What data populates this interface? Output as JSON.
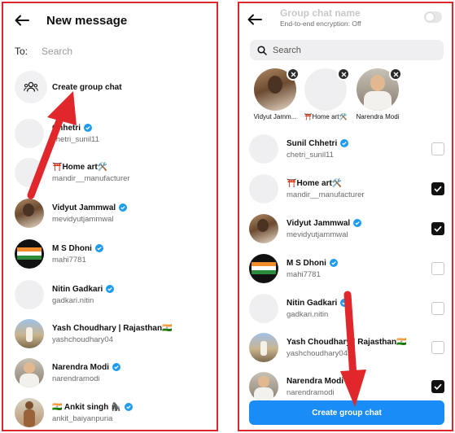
{
  "left": {
    "title": "New message",
    "to_label": "To:",
    "search_placeholder": "Search",
    "create_group_label": "Create group chat",
    "contacts": [
      {
        "name": "Chhetri",
        "handle": "chetri_sunil11",
        "verified": true,
        "icon": "blank-avatar"
      },
      {
        "name": "⛩️Home art🛠️",
        "handle": "mandir__manufacturer",
        "verified": false,
        "icon": "blank-avatar"
      },
      {
        "name": "Vidyut Jammwal",
        "handle": "mevidyutjammwal",
        "verified": true,
        "icon": "photo-avatar"
      },
      {
        "name": "M S Dhoni",
        "handle": "mahi7781",
        "verified": true,
        "icon": "photo-avatar"
      },
      {
        "name": "Nitin Gadkari",
        "handle": "gadkari.nitin",
        "verified": true,
        "icon": "blank-avatar"
      },
      {
        "name": "Yash Choudhary | Rajasthan🇮🇳",
        "handle": "yashchoudhary04",
        "verified": false,
        "icon": "photo-avatar"
      },
      {
        "name": "Narendra Modi",
        "handle": "narendramodi",
        "verified": true,
        "icon": "photo-avatar"
      },
      {
        "name": "🇮🇳 Ankit singh 🦍",
        "handle": "ankit_baiyanpuria",
        "verified": true,
        "icon": "photo-avatar"
      }
    ]
  },
  "right": {
    "group_name_placeholder": "Group chat name",
    "encryption_status": "End-to-end encryption: Off",
    "search_placeholder": "Search",
    "selected": [
      {
        "name": "Vidyut Jamm..."
      },
      {
        "name": "⛩️Home art🛠️"
      },
      {
        "name": "Narendra Modi"
      }
    ],
    "contacts": [
      {
        "name": "Sunil Chhetri",
        "handle": "chetri_sunil11",
        "verified": true,
        "checked": false
      },
      {
        "name": "⛩️Home art🛠️",
        "handle": "mandir__manufacturer",
        "verified": false,
        "checked": true
      },
      {
        "name": "Vidyut Jammwal",
        "handle": "mevidyutjammwal",
        "verified": true,
        "checked": true
      },
      {
        "name": "M S Dhoni",
        "handle": "mahi7781",
        "verified": true,
        "checked": false
      },
      {
        "name": "Nitin Gadkari",
        "handle": "gadkari.nitin",
        "verified": true,
        "checked": false
      },
      {
        "name": "Yash Choudhary | Rajasthan🇮🇳",
        "handle": "yashchoudhary04",
        "verified": false,
        "checked": false
      },
      {
        "name": "Narendra Modi",
        "handle": "narendramodi",
        "verified": true,
        "checked": true
      }
    ],
    "create_button_label": "Create group chat"
  },
  "colors": {
    "accent_blue": "#1a8cf5",
    "verified_blue": "#1d9bf0",
    "annotation_red": "#e0272b"
  }
}
